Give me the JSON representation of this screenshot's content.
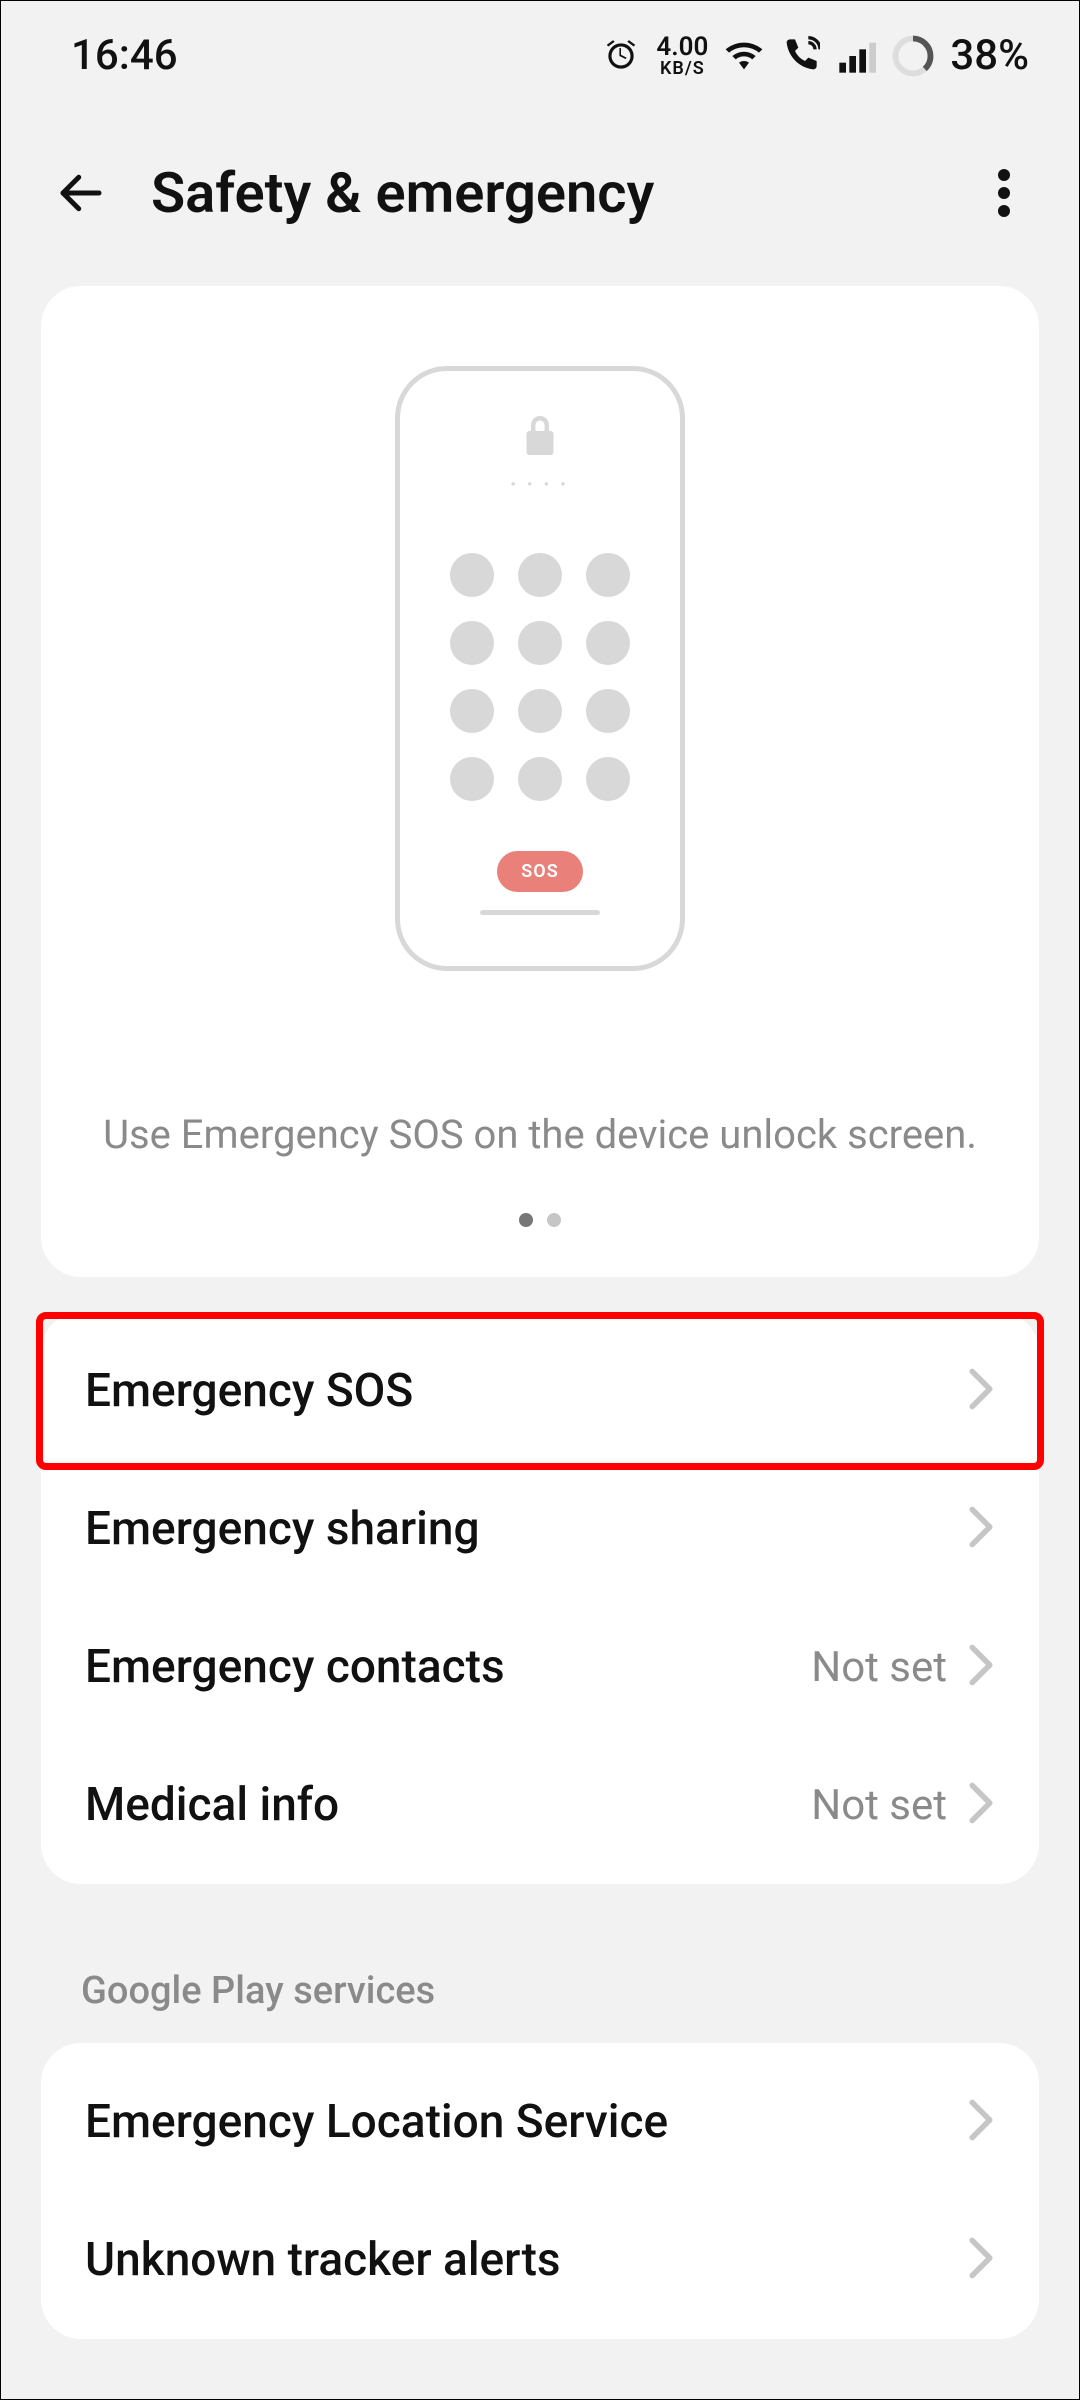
{
  "status_bar": {
    "time": "16:46",
    "net_speed_value": "4.00",
    "net_speed_unit": "KB/S",
    "battery": "38%"
  },
  "header": {
    "title": "Safety & emergency"
  },
  "hero": {
    "sos_label": "SOS",
    "caption": "Use Emergency SOS on the device unlock screen."
  },
  "list": {
    "items": [
      {
        "label": "Emergency SOS",
        "value": ""
      },
      {
        "label": "Emergency sharing",
        "value": ""
      },
      {
        "label": "Emergency contacts",
        "value": "Not set"
      },
      {
        "label": "Medical info",
        "value": "Not set"
      }
    ]
  },
  "section": {
    "title": "Google Play services",
    "items": [
      {
        "label": "Emergency Location Service",
        "value": ""
      },
      {
        "label": "Unknown tracker alerts",
        "value": ""
      }
    ]
  },
  "highlight_index": 0
}
